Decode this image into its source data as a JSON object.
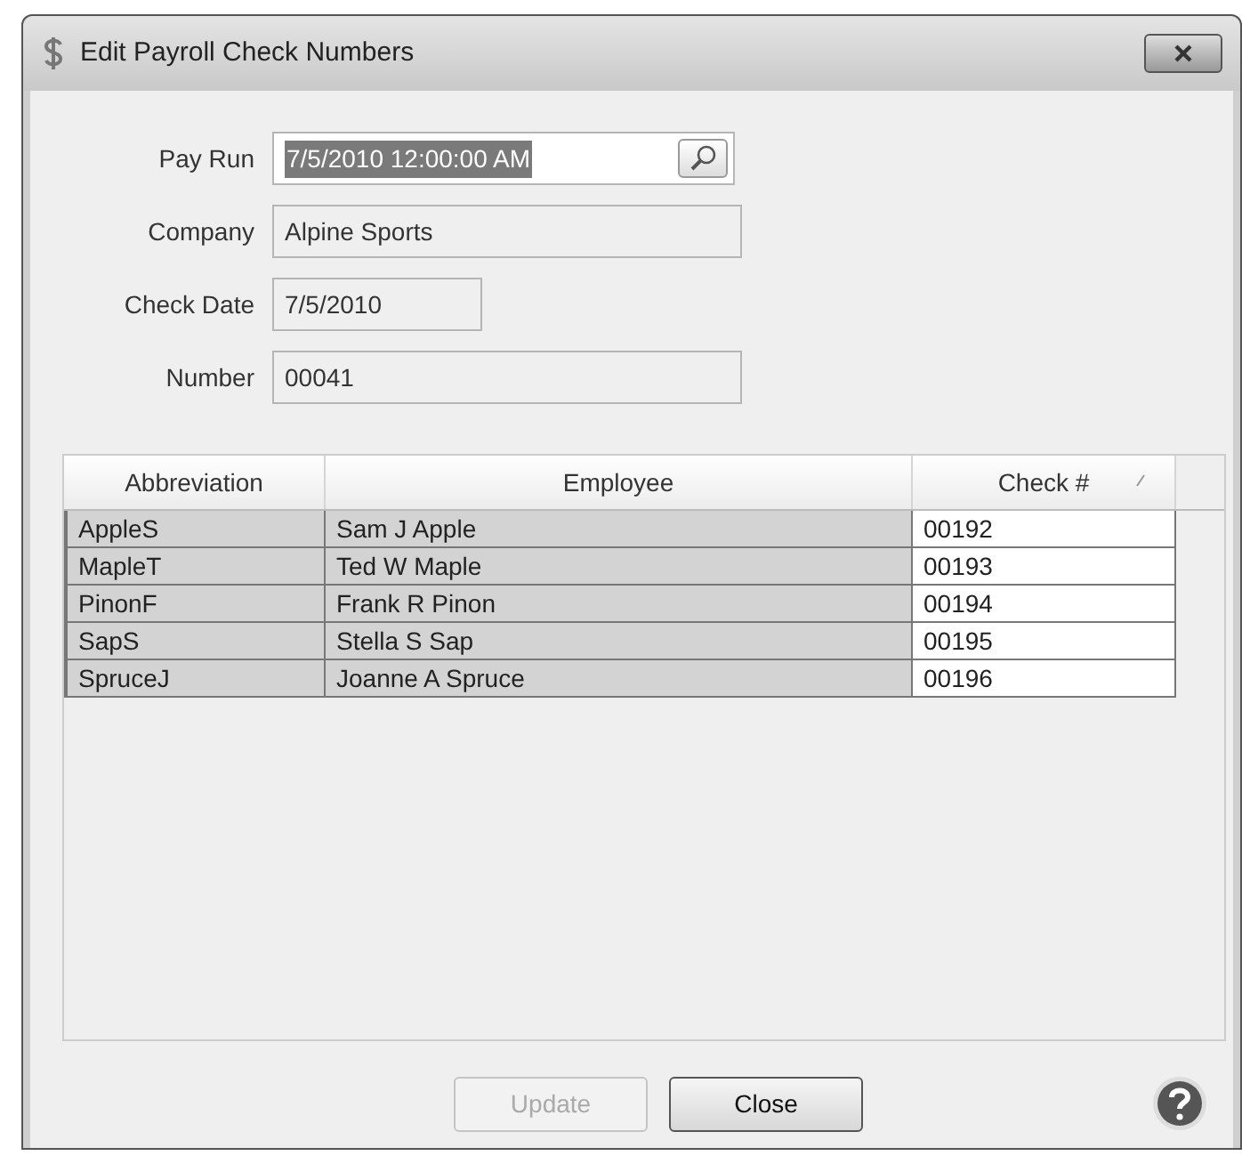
{
  "window": {
    "title": "Edit Payroll Check Numbers"
  },
  "fields": [
    {
      "label": "Pay Run",
      "value": "7/5/2010 12:00:00 AM",
      "kind": "lookup",
      "highlighted": true
    },
    {
      "label": "Company",
      "value": "Alpine Sports",
      "kind": "readonly",
      "highlighted": false
    },
    {
      "label": "Check Date",
      "value": "7/5/2010",
      "kind": "short",
      "highlighted": false
    },
    {
      "label": "Number",
      "value": "00041",
      "kind": "readonly",
      "highlighted": false
    }
  ],
  "table": {
    "columns": [
      "Abbreviation",
      "Employee",
      "Check #"
    ],
    "rows": [
      [
        "AppleS",
        "Sam J Apple",
        "00192"
      ],
      [
        "MapleT",
        "Ted W Maple",
        "00193"
      ],
      [
        "PinonF",
        "Frank R Pinon",
        "00194"
      ],
      [
        "SapS",
        "Stella S Sap",
        "00195"
      ],
      [
        "SpruceJ",
        "Joanne A Spruce",
        "00196"
      ]
    ]
  },
  "buttons": [
    {
      "label": "Update",
      "disabled": true
    },
    {
      "label": "Close",
      "disabled": false
    }
  ]
}
